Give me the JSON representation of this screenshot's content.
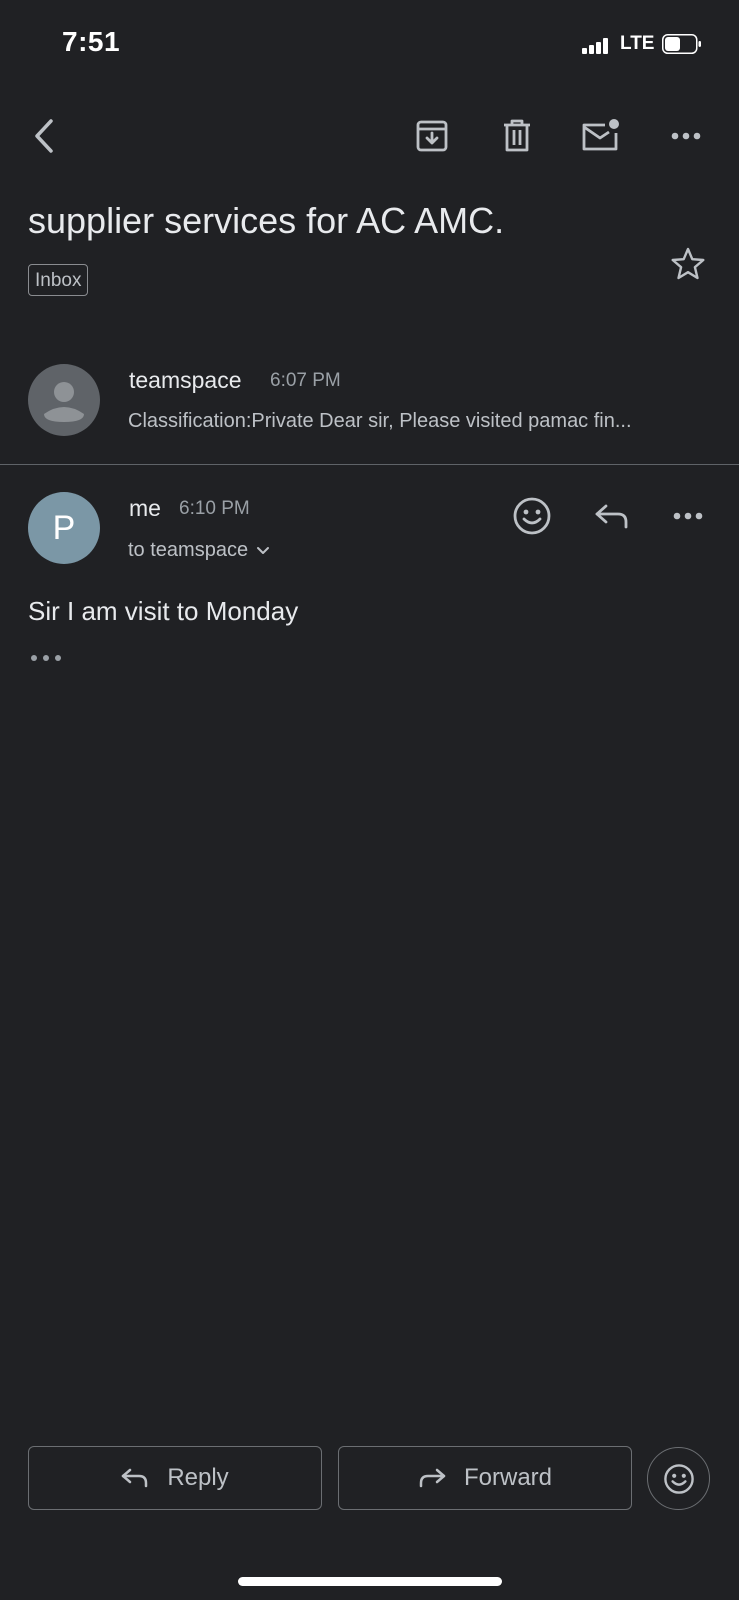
{
  "status_bar": {
    "time": "7:51",
    "network": "LTE",
    "icons": [
      "signal-icon",
      "battery-icon"
    ]
  },
  "toolbar": {
    "icons": [
      "back-chevron-icon",
      "archive-icon",
      "trash-icon",
      "mark-unread-icon",
      "more-icon"
    ]
  },
  "email": {
    "subject": "supplier services for AC AMC.",
    "label": "Inbox"
  },
  "messages": [
    {
      "sender": "teamspace",
      "time": "6:07 PM",
      "snippet": "Classification:Private Dear sir, Please visited pamac fin..."
    },
    {
      "sender": "me",
      "avatar_letter": "P",
      "time": "6:10 PM",
      "to": "to teamspace",
      "body": "Sir I am visit to Monday"
    }
  ],
  "actions": {
    "reply_label": "Reply",
    "forward_label": "Forward"
  },
  "colors": {
    "background": "#202124",
    "text_primary": "#e8eaed",
    "text_secondary": "#bdc1c6",
    "avatar_letter_bg": "#7b97a6"
  }
}
